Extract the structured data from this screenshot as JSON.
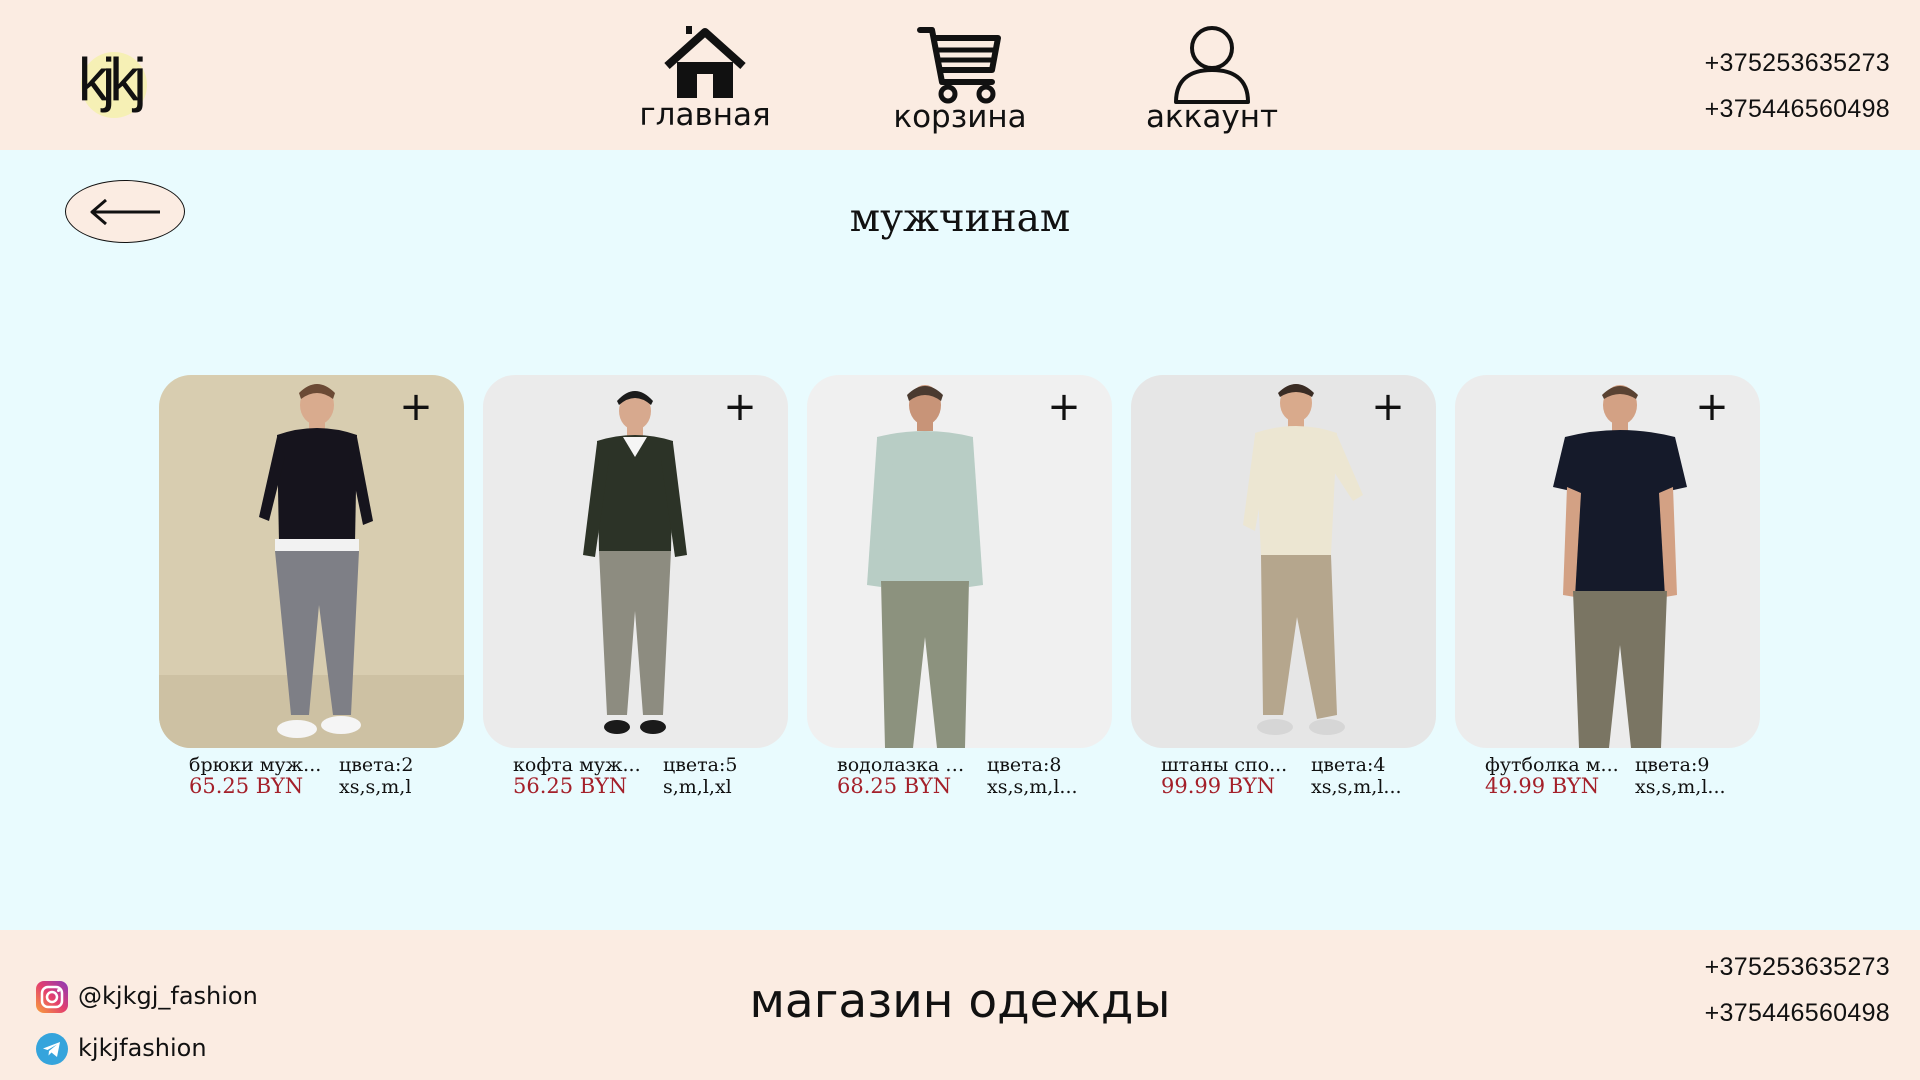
{
  "header": {
    "logo_text": "kjkj",
    "nav": [
      {
        "label": "главная",
        "icon": "home-icon"
      },
      {
        "label": "корзина",
        "icon": "cart-icon"
      },
      {
        "label": "аккаунт",
        "icon": "account-icon"
      }
    ],
    "phones": [
      "+375253635273",
      "+375446560498"
    ]
  },
  "main": {
    "back_icon": "arrow-left-icon",
    "title": "мужчинам",
    "add_icon": "plus-icon",
    "products": [
      {
        "name": "брюки муж...",
        "price": "65.25 BYN",
        "colors": "цвета:2",
        "sizes": "xs,s,m,l"
      },
      {
        "name": "кофта муж...",
        "price": "56.25 BYN",
        "colors": "цвета:5",
        "sizes": "s,m,l,xl"
      },
      {
        "name": "водолазка м...",
        "price": "68.25 BYN",
        "colors": "цвета:8",
        "sizes": "xs,s,m,l..."
      },
      {
        "name": "штаны спо...",
        "price": "99.99 BYN",
        "colors": "цвета:4",
        "sizes": "xs,s,m,l..."
      },
      {
        "name": "футболка м...",
        "price": "49.99 BYN",
        "colors": "цвета:9",
        "sizes": "xs,s,m,l..."
      }
    ]
  },
  "footer": {
    "instagram": "@kjkgj_fashion",
    "telegram": "kjkjfashion",
    "title": "магазин одежды",
    "phones": [
      "+375253635273",
      "+375446560498"
    ]
  },
  "colors": {
    "header_bg": "#fbece2",
    "main_bg": "#e9fbfe",
    "price": "#a4202a"
  }
}
